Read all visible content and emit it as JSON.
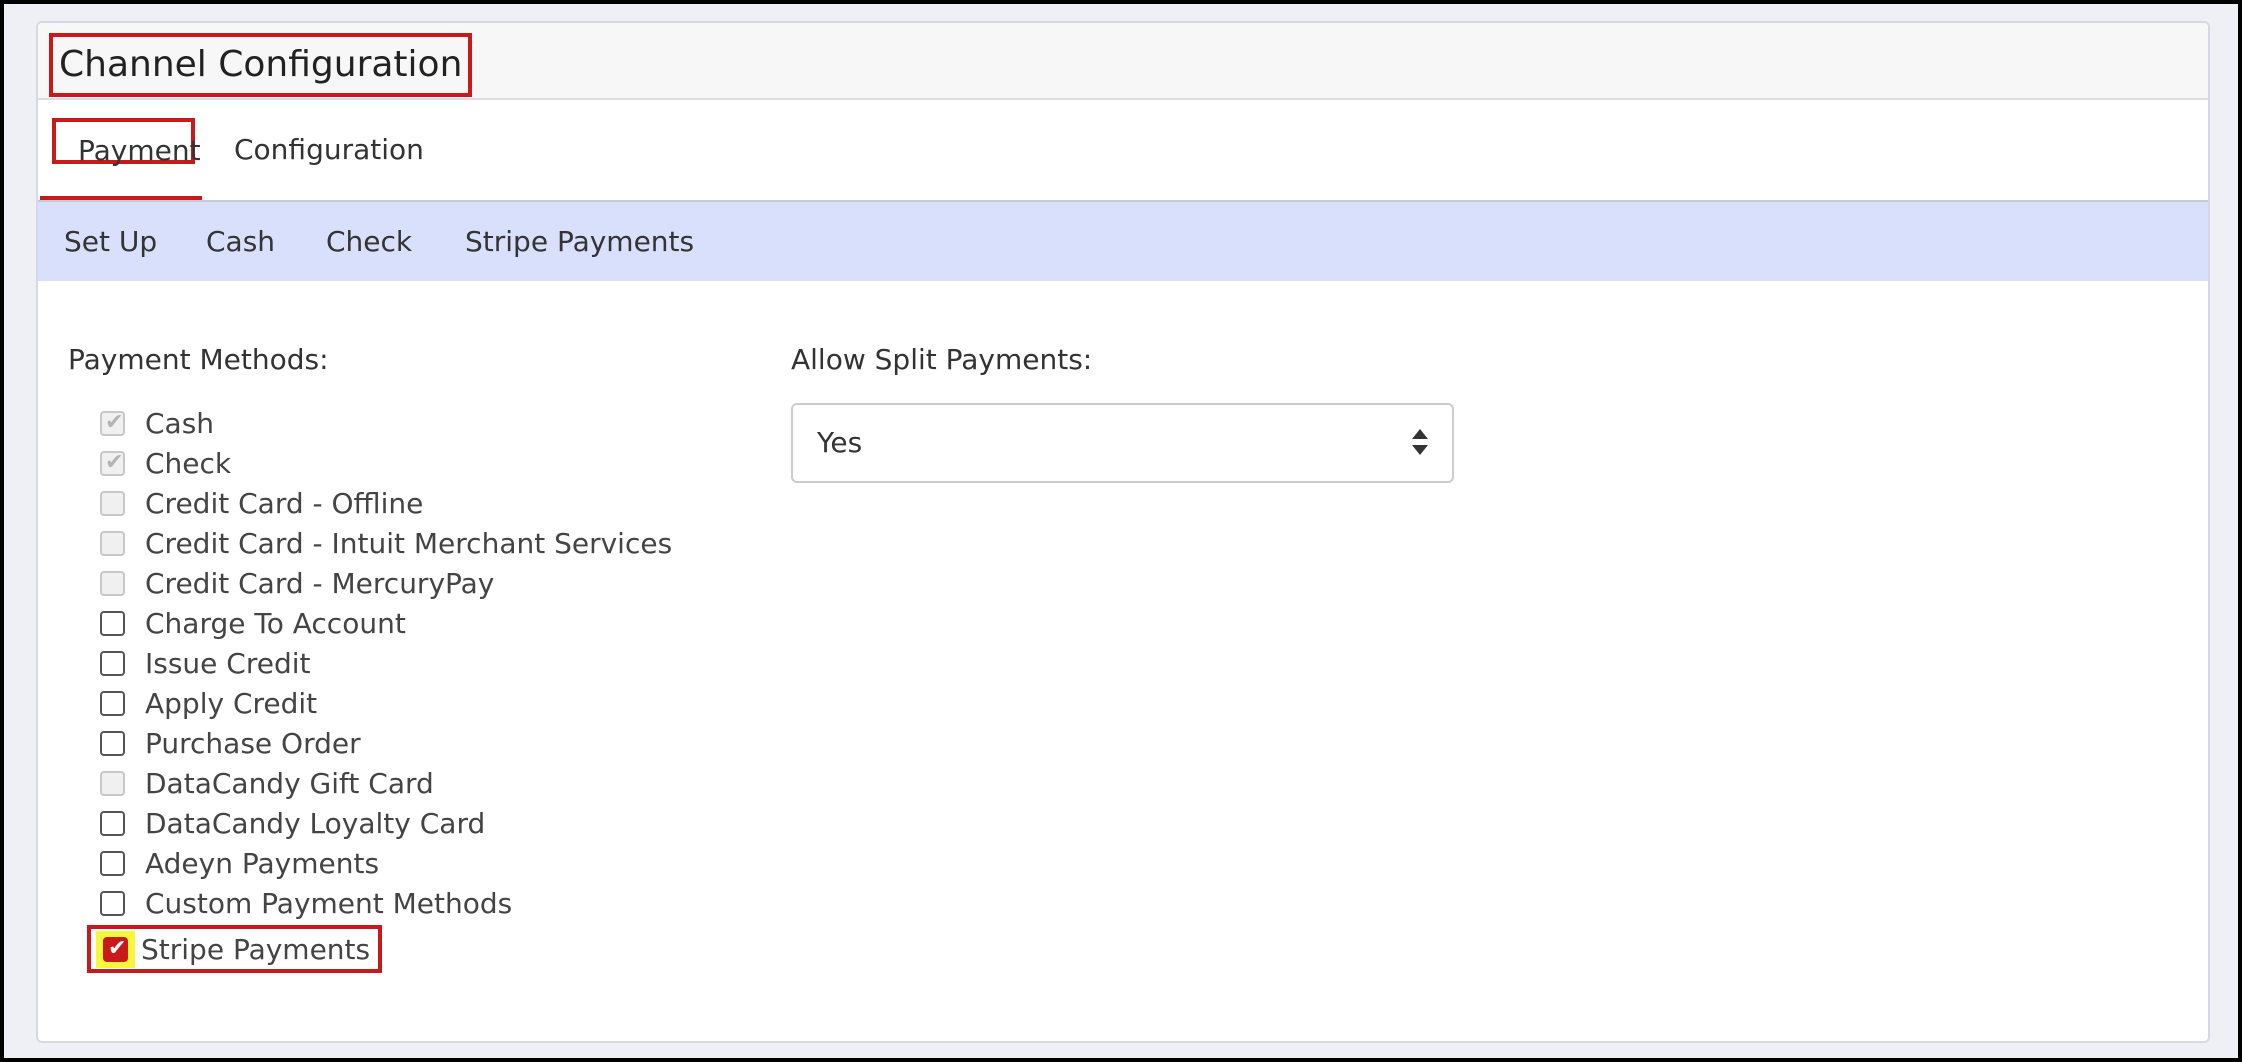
{
  "header": {
    "title": "Channel Configuration"
  },
  "tabs": [
    {
      "label": "Payment",
      "active": true
    },
    {
      "label": "Configuration",
      "active": false
    }
  ],
  "subnav": [
    "Set Up",
    "Cash",
    "Check",
    "Stripe Payments"
  ],
  "payment_methods": {
    "label": "Payment Methods:",
    "items": [
      {
        "label": "Cash",
        "checked": true,
        "disabled": true
      },
      {
        "label": "Check",
        "checked": true,
        "disabled": true
      },
      {
        "label": "Credit Card - Offline",
        "checked": false,
        "disabled": true
      },
      {
        "label": "Credit Card - Intuit Merchant Services",
        "checked": false,
        "disabled": true
      },
      {
        "label": "Credit Card - MercuryPay",
        "checked": false,
        "disabled": true
      },
      {
        "label": "Charge To Account",
        "checked": false,
        "disabled": false
      },
      {
        "label": "Issue Credit",
        "checked": false,
        "disabled": false
      },
      {
        "label": "Apply Credit",
        "checked": false,
        "disabled": false
      },
      {
        "label": "Purchase Order",
        "checked": false,
        "disabled": false
      },
      {
        "label": "DataCandy Gift Card",
        "checked": false,
        "disabled": true
      },
      {
        "label": "DataCandy Loyalty Card",
        "checked": false,
        "disabled": false
      },
      {
        "label": "Adeyn Payments",
        "checked": false,
        "disabled": false
      },
      {
        "label": "Custom Payment Methods",
        "checked": false,
        "disabled": false
      },
      {
        "label": "Stripe Payments",
        "checked": true,
        "disabled": false
      }
    ]
  },
  "split_payments": {
    "label": "Allow Split Payments:",
    "value": "Yes"
  },
  "colors": {
    "highlight_border": "#c8191b",
    "subnav_bg": "#d8e0fb",
    "highlight_fill": "#f6f63a"
  }
}
